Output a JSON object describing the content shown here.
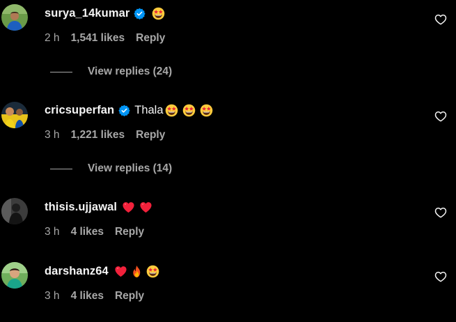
{
  "colors": {
    "background": "#000000",
    "text": "#f5f5f5",
    "muted": "#a8a8a8",
    "verified": "#0095f6",
    "heart_red": "#ff3040"
  },
  "comments": [
    {
      "username": "surya_14kumar",
      "verified": true,
      "text": "",
      "emojis": [
        "star-struck-emoji"
      ],
      "time": "2 h",
      "likes": "1,541 likes",
      "reply_label": "Reply",
      "view_replies": "View replies (24)"
    },
    {
      "username": "cricsuperfan",
      "verified": true,
      "text": "Thala",
      "emojis": [
        "star-struck-emoji",
        "star-struck-emoji",
        "star-struck-emoji"
      ],
      "time": "3 h",
      "likes": "1,221 likes",
      "reply_label": "Reply",
      "view_replies": "View replies (14)"
    },
    {
      "username": "thisis.ujjawal",
      "verified": false,
      "text": "",
      "emojis": [
        "red-heart-emoji",
        "red-heart-emoji"
      ],
      "time": "3 h",
      "likes": "4 likes",
      "reply_label": "Reply"
    },
    {
      "username": "darshanz64",
      "verified": false,
      "text": "",
      "emojis": [
        "red-heart-emoji",
        "fire-emoji",
        "star-struck-emoji"
      ],
      "time": "3 h",
      "likes": "4 likes",
      "reply_label": "Reply"
    }
  ]
}
